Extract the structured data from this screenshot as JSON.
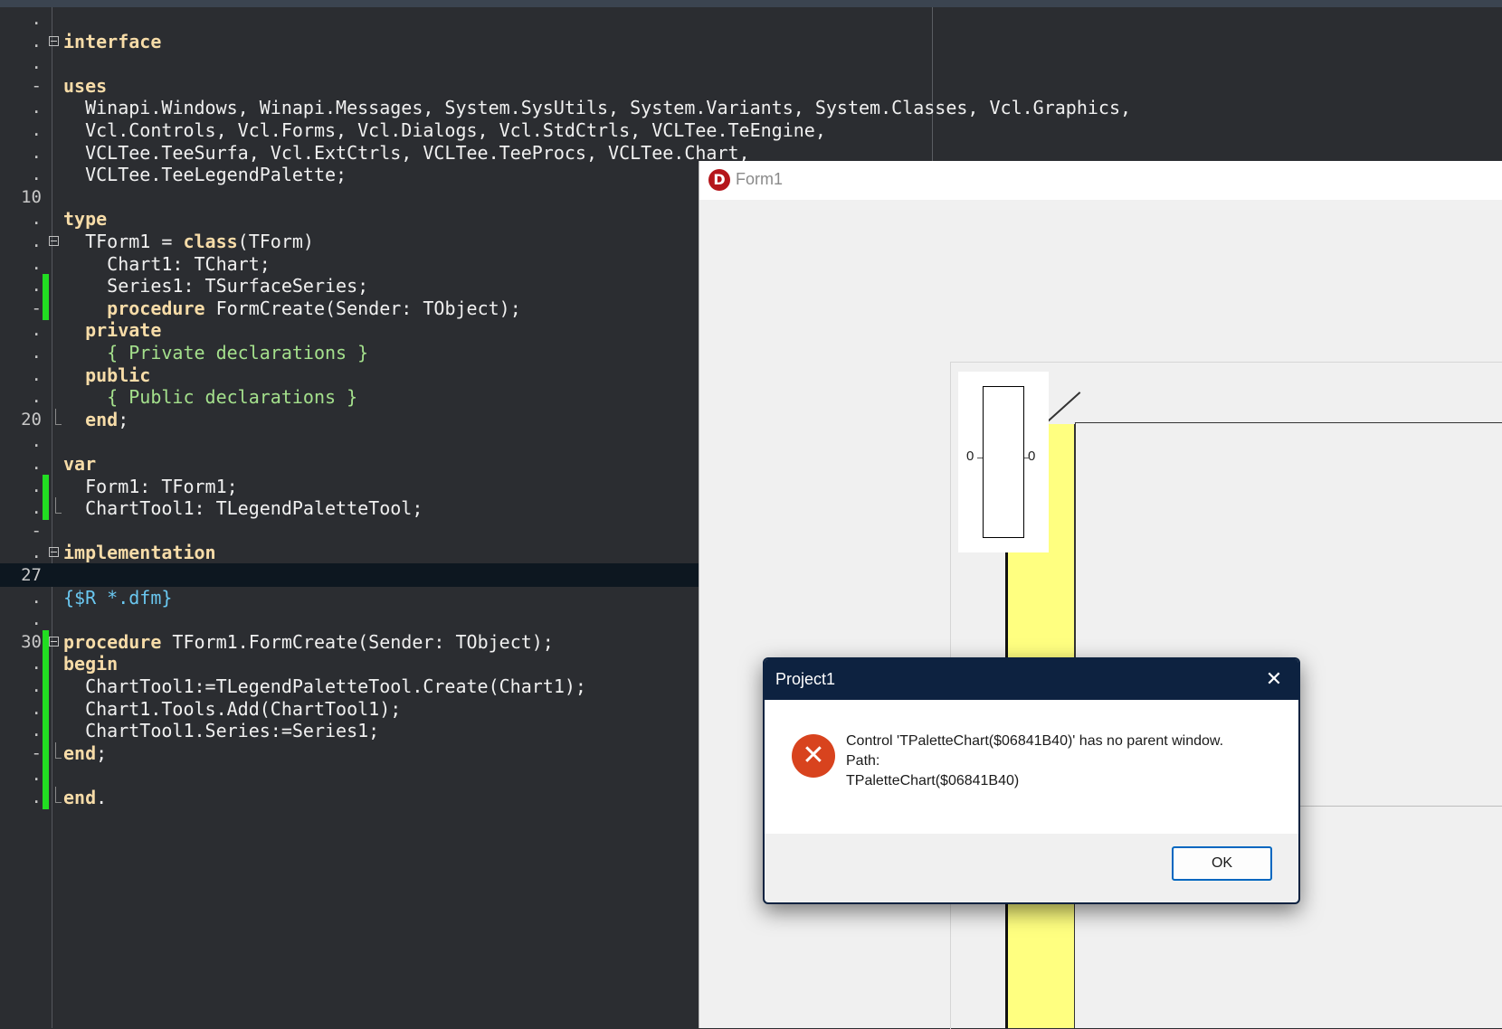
{
  "editor": {
    "lines": [
      {
        "num": ".",
        "spans": [
          {
            "t": "",
            "c": ""
          }
        ]
      },
      {
        "num": ".",
        "fold": true,
        "spans": [
          {
            "t": "interface",
            "c": "kw"
          }
        ]
      },
      {
        "num": ".",
        "spans": [
          {
            "t": "",
            "c": ""
          }
        ]
      },
      {
        "num": "-",
        "spans": [
          {
            "t": "uses",
            "c": "kw"
          }
        ]
      },
      {
        "num": ".",
        "spans": [
          {
            "t": "  Winapi.Windows, Winapi.Messages, System.SysUtils, System.Variants, System.Classes, Vcl.Graphics,",
            "c": ""
          }
        ]
      },
      {
        "num": ".",
        "spans": [
          {
            "t": "  Vcl.Controls, Vcl.Forms, Vcl.Dialogs, Vcl.StdCtrls, VCLTee.TeEngine,",
            "c": ""
          }
        ]
      },
      {
        "num": ".",
        "spans": [
          {
            "t": "  VCLTee.TeeSurfa, Vcl.ExtCtrls, VCLTee.TeeProcs, VCLTee.Chart,",
            "c": ""
          }
        ]
      },
      {
        "num": ".",
        "spans": [
          {
            "t": "  VCLTee.TeeLegendPalette;",
            "c": ""
          }
        ]
      },
      {
        "num": "10",
        "spans": [
          {
            "t": "",
            "c": ""
          }
        ]
      },
      {
        "num": ".",
        "spans": [
          {
            "t": "type",
            "c": "kw"
          }
        ]
      },
      {
        "num": ".",
        "fold": true,
        "spans": [
          {
            "t": "  TForm1 = ",
            "c": ""
          },
          {
            "t": "class",
            "c": "kw"
          },
          {
            "t": "(TForm)",
            "c": ""
          }
        ]
      },
      {
        "num": ".",
        "spans": [
          {
            "t": "    Chart1: TChart;",
            "c": ""
          }
        ]
      },
      {
        "num": ".",
        "mark": true,
        "spans": [
          {
            "t": "    Series1: TSurfaceSeries;",
            "c": ""
          }
        ]
      },
      {
        "num": "-",
        "mark": true,
        "spans": [
          {
            "t": "    ",
            "c": ""
          },
          {
            "t": "procedure",
            "c": "kw"
          },
          {
            "t": " FormCreate(Sender: TObject);",
            "c": ""
          }
        ]
      },
      {
        "num": ".",
        "spans": [
          {
            "t": "  private",
            "c": "kw"
          }
        ]
      },
      {
        "num": ".",
        "spans": [
          {
            "t": "    { Private declarations }",
            "c": "cm"
          }
        ]
      },
      {
        "num": ".",
        "spans": [
          {
            "t": "  public",
            "c": "kw"
          }
        ]
      },
      {
        "num": ".",
        "spans": [
          {
            "t": "    { Public declarations }",
            "c": "cm"
          }
        ]
      },
      {
        "num": "20",
        "end": true,
        "spans": [
          {
            "t": "  end",
            "c": "kw"
          },
          {
            "t": ";",
            "c": ""
          }
        ]
      },
      {
        "num": ".",
        "spans": [
          {
            "t": "",
            "c": ""
          }
        ]
      },
      {
        "num": ".",
        "spans": [
          {
            "t": "var",
            "c": "kw"
          }
        ]
      },
      {
        "num": ".",
        "mark": true,
        "spans": [
          {
            "t": "  Form1: TForm1;",
            "c": ""
          }
        ]
      },
      {
        "num": ".",
        "mark": true,
        "end": true,
        "spans": [
          {
            "t": "  ChartTool1: TLegendPaletteTool;",
            "c": ""
          }
        ]
      },
      {
        "num": "-",
        "spans": [
          {
            "t": "",
            "c": ""
          }
        ]
      },
      {
        "num": ".",
        "fold": true,
        "spans": [
          {
            "t": "implementation",
            "c": "kw"
          }
        ]
      },
      {
        "num": "27",
        "current": true,
        "spans": [
          {
            "t": "",
            "c": ""
          }
        ]
      },
      {
        "num": ".",
        "spans": [
          {
            "t": "{$R *.dfm}",
            "c": "dir"
          }
        ]
      },
      {
        "num": ".",
        "spans": [
          {
            "t": "",
            "c": ""
          }
        ]
      },
      {
        "num": "30",
        "fold": true,
        "mark": true,
        "spans": [
          {
            "t": "procedure",
            "c": "kw"
          },
          {
            "t": " TForm1.FormCreate(Sender: TObject);",
            "c": ""
          }
        ]
      },
      {
        "num": ".",
        "mark": true,
        "spans": [
          {
            "t": "begin",
            "c": "kw"
          }
        ]
      },
      {
        "num": ".",
        "mark": true,
        "spans": [
          {
            "t": "  ChartTool1:=TLegendPaletteTool.Create(Chart1);",
            "c": ""
          }
        ]
      },
      {
        "num": ".",
        "mark": true,
        "spans": [
          {
            "t": "  Chart1.Tools.Add(ChartTool1);",
            "c": ""
          }
        ]
      },
      {
        "num": ".",
        "mark": true,
        "spans": [
          {
            "t": "  ChartTool1.Series:=Series1;",
            "c": ""
          }
        ]
      },
      {
        "num": "-",
        "mark": true,
        "end": true,
        "spans": [
          {
            "t": "end",
            "c": "kw"
          },
          {
            "t": ";",
            "c": ""
          }
        ]
      },
      {
        "num": ".",
        "mark": true,
        "spans": [
          {
            "t": "",
            "c": ""
          }
        ]
      },
      {
        "num": ".",
        "mark": true,
        "end": true,
        "spans": [
          {
            "t": "end",
            "c": "kw"
          },
          {
            "t": ".",
            "c": ""
          }
        ]
      }
    ]
  },
  "form1": {
    "title": "Form1",
    "logo_letter": "D",
    "legend": {
      "left_label": "0",
      "right_label": "0"
    }
  },
  "dialog": {
    "title": "Project1",
    "close_glyph": "✕",
    "icon_glyph": "✕",
    "message_line1": "Control 'TPaletteChart($06841B40)' has no parent window.",
    "message_line2": "Path:",
    "message_line3": "TPaletteChart($06841B40)",
    "ok_label": "OK"
  },
  "colors": {
    "editor_bg": "#2b2d31",
    "keyword": "#f7dca8",
    "comment": "#a4e08c",
    "directive": "#6ac7f0",
    "modified_marker": "#22dd22",
    "dialog_title_bg": "#0d2240",
    "error_icon": "#d8431e",
    "surface_yellow": "#ffff80"
  }
}
